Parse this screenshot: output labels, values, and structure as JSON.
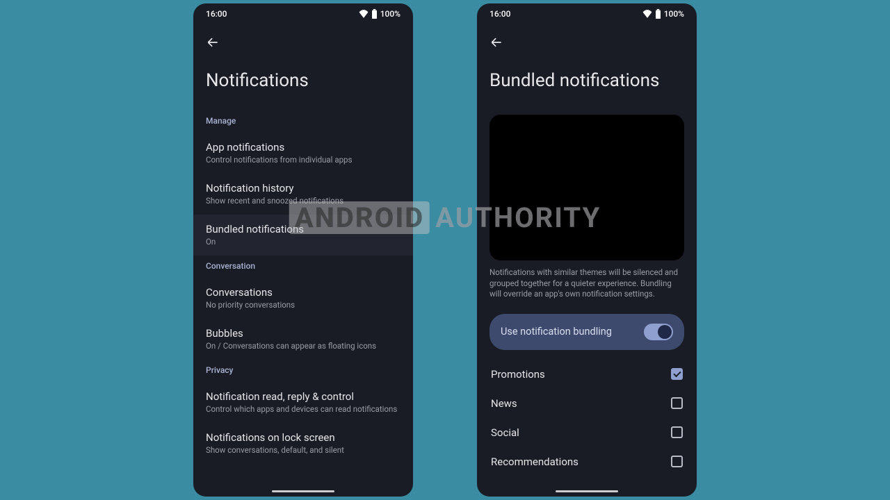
{
  "status": {
    "time": "16:00",
    "battery": "100%"
  },
  "watermark": {
    "boxed": "ANDROID",
    "rest": "AUTHORITY"
  },
  "left": {
    "title": "Notifications",
    "sections": [
      {
        "header": "Manage",
        "items": [
          {
            "title": "App notifications",
            "sub": "Control notifications from individual apps",
            "highlight": false
          },
          {
            "title": "Notification history",
            "sub": "Show recent and snoozed notifications",
            "highlight": false
          },
          {
            "title": "Bundled notifications",
            "sub": "On",
            "highlight": true
          }
        ]
      },
      {
        "header": "Conversation",
        "items": [
          {
            "title": "Conversations",
            "sub": "No priority conversations",
            "highlight": false
          },
          {
            "title": "Bubbles",
            "sub": "On / Conversations can appear as floating icons",
            "highlight": false
          }
        ]
      },
      {
        "header": "Privacy",
        "items": [
          {
            "title": "Notification read, reply & control",
            "sub": "Control which apps and devices can read notifications",
            "highlight": false
          },
          {
            "title": "Notifications on lock screen",
            "sub": "Show conversations, default, and silent",
            "highlight": false
          }
        ]
      }
    ]
  },
  "right": {
    "title": "Bundled notifications",
    "description": "Notifications with similar themes will be silenced and grouped together for a quieter experience. Bundling will override an app's own notification settings.",
    "toggle": {
      "label": "Use notification bundling",
      "on": true
    },
    "categories": [
      {
        "label": "Promotions",
        "checked": true
      },
      {
        "label": "News",
        "checked": false
      },
      {
        "label": "Social",
        "checked": false
      },
      {
        "label": "Recommendations",
        "checked": false
      }
    ]
  }
}
